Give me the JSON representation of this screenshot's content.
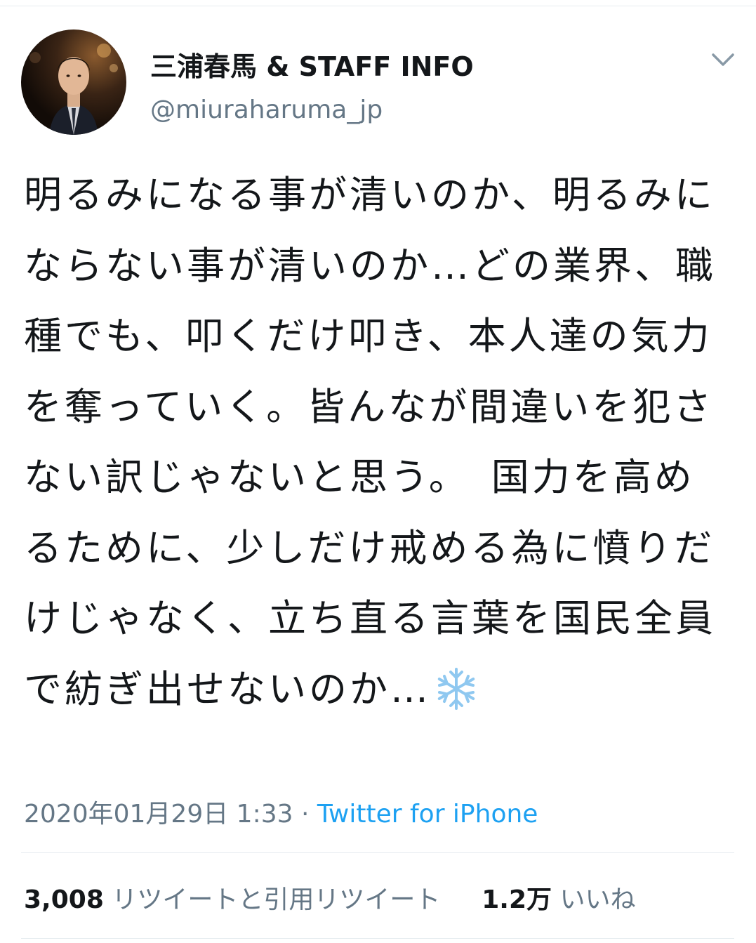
{
  "tweet": {
    "author": {
      "display_name": "三浦春馬 & STAFF INFO",
      "handle": "@miuraharuma_jp",
      "avatar_icon": "profile-photo"
    },
    "text": "明るみになる事が清いのか、明るみにならない事が清いのか…どの業界、職種でも、叩くだけ叩き、本人達の気力を奪っていく。皆んなが間違いを犯さない訳じゃないと思う。　国力を高めるために、少しだけ戒める為に憤りだけじゃなく、立ち直る言葉を国民全員で紡ぎ出せないのか…",
    "emoji": "❄️",
    "timestamp": "2020年01月29日 1:33",
    "separator": "·",
    "source": "Twitter for iPhone",
    "stats": {
      "retweets_count": "3,008",
      "retweets_label": "リツイートと引用リツイート",
      "likes_count": "1.2万",
      "likes_label": "いいね"
    }
  },
  "colors": {
    "text_primary": "#14171a",
    "text_secondary": "#657786",
    "link": "#1da1f2",
    "divider": "#e6ecf0"
  },
  "icons": {
    "menu": "chevron-down-icon",
    "emoji": "snowflake-icon"
  }
}
